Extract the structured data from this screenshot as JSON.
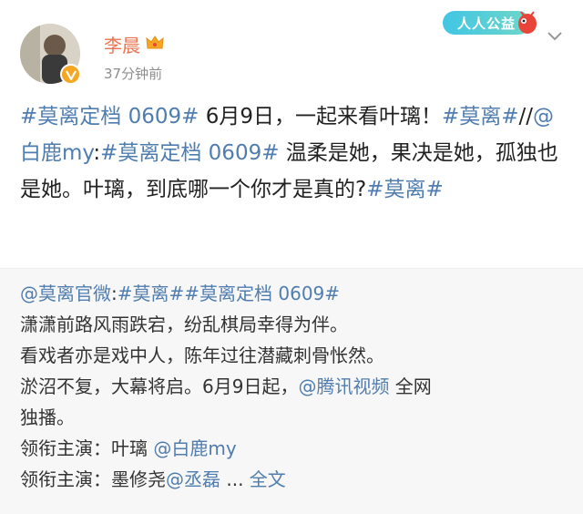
{
  "header": {
    "username": "李晨",
    "time": "37分钟前",
    "badge_label": "人人公益",
    "icons": {
      "verified": "verified-v-icon",
      "member": "crown-icon",
      "more": "chevron-down-icon"
    }
  },
  "post": {
    "seg1": "#莫离定档 0609#",
    "seg2": " 6月9日，一起来看叶璃！",
    "seg3": "#莫离#",
    "seg4": "//",
    "seg5": "@白鹿my",
    "seg6": ":",
    "seg7": "#莫离定档 0609#",
    "seg8": " 温柔是她，果决是她，孤独也是她。叶璃，到底哪一个你才是真的?",
    "seg9": "#莫离#"
  },
  "repost": {
    "source": "@莫离官微",
    "colon": ":",
    "tag1": "#莫离#",
    "tag2": "#莫离定档 0609#",
    "line2": "潇潇前路风雨跌宕，纷乱棋局幸得为伴。",
    "line3": "看戏者亦是戏中人，陈年过往潜藏刺骨怅然。",
    "line4a": "淤沼不复，大幕将启。6月9日起，",
    "line4_link": "@腾讯视频",
    "line4b": " 全网",
    "line5": "独播。",
    "line6_label": "领衔主演：叶璃 ",
    "line6_link": "@白鹿my",
    "line7_label": "领衔主演：墨修尧",
    "line7_link": "@丞磊",
    "ellipsis": " ... ",
    "fulltext": "全文"
  },
  "colors": {
    "accent": "#eb7350",
    "link": "#507daf",
    "badge": "#41c6e4",
    "verified": "#f5a623"
  }
}
